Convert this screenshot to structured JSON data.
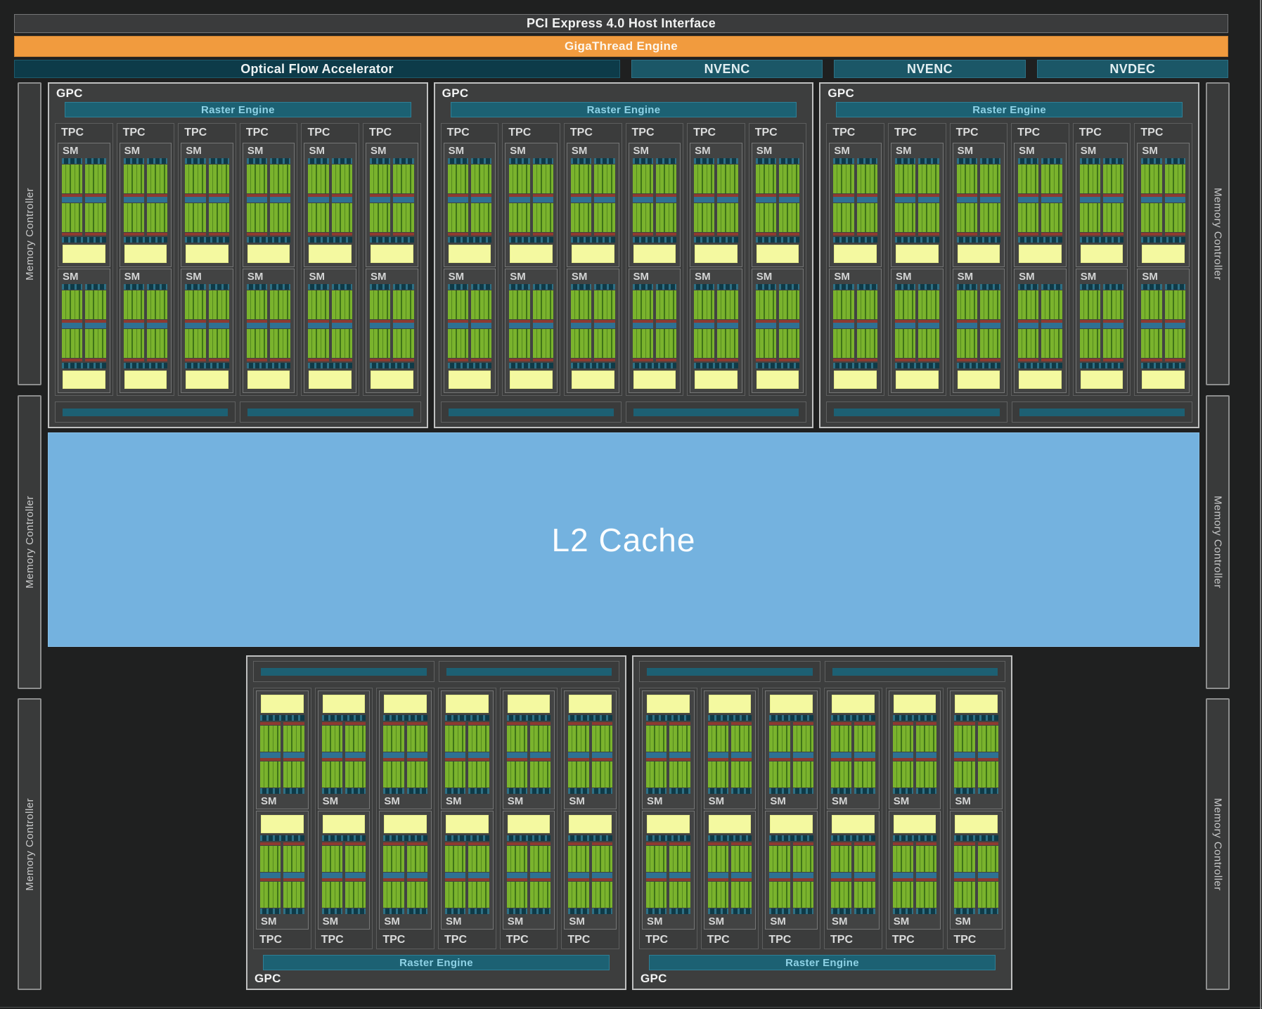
{
  "top_bars": {
    "pci_label": "PCI Express 4.0 Host Interface",
    "gigathread_label": "GigaThread Engine",
    "optical_flow_label": "Optical Flow Accelerator",
    "encoder_labels": [
      "NVENC",
      "NVENC",
      "NVDEC"
    ]
  },
  "blocks": {
    "gpc_label": "GPC",
    "raster_engine_label": "Raster Engine",
    "tpc_label": "TPC",
    "sm_label": "SM",
    "l2_label": "L2 Cache",
    "memory_controller_label": "Memory Controller"
  },
  "structure": {
    "top_gpc_count": 3,
    "bottom_gpc_count": 2,
    "tpcs_per_gpc": 6,
    "sms_per_tpc": 2,
    "rop_partitions_per_gpc": 2,
    "memory_controllers_per_side": 3
  },
  "colors": {
    "background": "#1f2020",
    "gigathread_orange": "#f19b3e",
    "media_teal": "#1b5767",
    "optical_flow_teal": "#0d3b49",
    "raster_teal": "#1c6173",
    "rop_teal": "#1d6073",
    "l2_blue": "#74b2df",
    "core_green": "#7ab32d",
    "rt_yellow": "#f4f9a0",
    "scheduler_blue": "#2e7193",
    "accent_red": "#8e3a30"
  }
}
